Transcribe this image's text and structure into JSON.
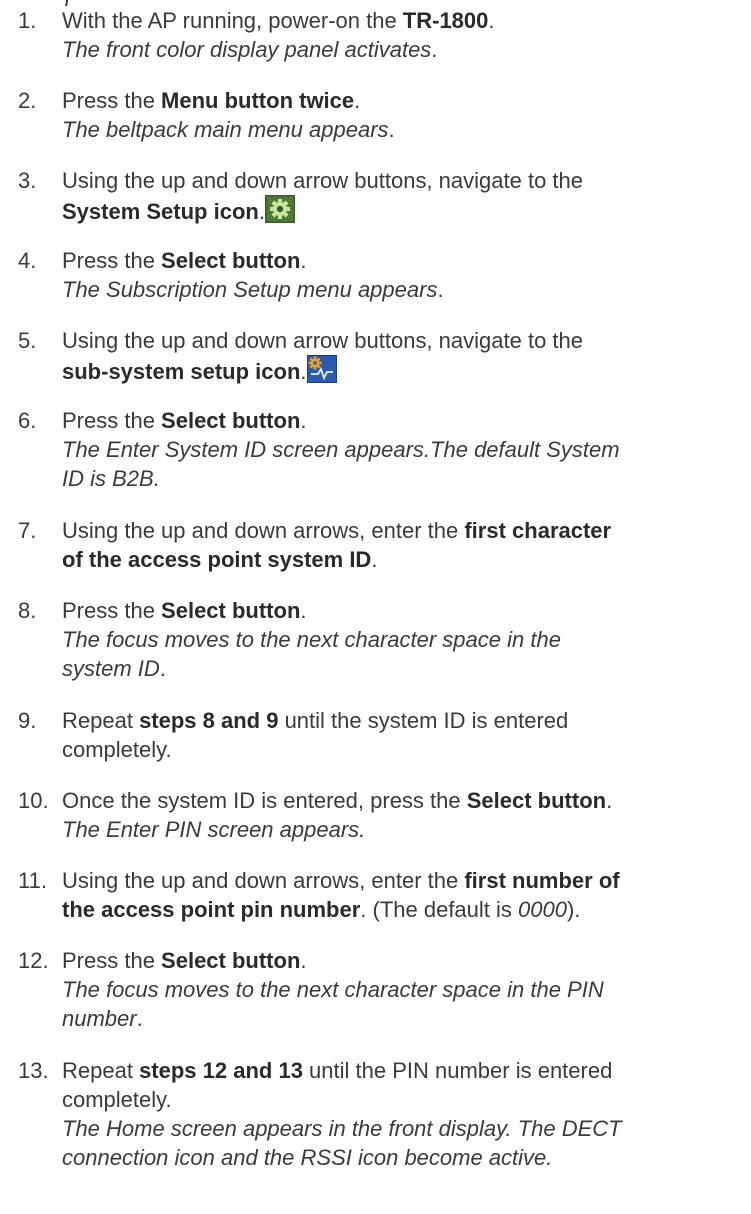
{
  "steps": [
    {
      "num": "1.",
      "lines": [
        [
          {
            "t": "With the AP running, power-on the "
          },
          {
            "t": "TR-1800",
            "b": true
          },
          {
            "t": "."
          }
        ],
        [
          {
            "t": "The front color display panel activates",
            "i": true
          },
          {
            "t": "."
          }
        ]
      ]
    },
    {
      "num": "2.",
      "lines": [
        [
          {
            "t": "Press the "
          },
          {
            "t": "Menu button twice",
            "b": true
          },
          {
            "t": "."
          }
        ],
        [
          {
            "t": "The beltpack main menu appears",
            "i": true
          },
          {
            "t": "."
          }
        ]
      ]
    },
    {
      "num": "3.",
      "lines": [
        [
          {
            "t": "Using the up and down arrow buttons, navigate to the"
          }
        ],
        [
          {
            "t": "System Setup icon",
            "b": true
          },
          {
            "t": "."
          },
          {
            "icon": "gear-icon"
          }
        ]
      ]
    },
    {
      "num": "4.",
      "lines": [
        [
          {
            "t": "Press the "
          },
          {
            "t": "Select button",
            "b": true
          },
          {
            "t": "."
          }
        ],
        [
          {
            "t": "The Subscription Setup menu appears",
            "i": true
          },
          {
            "t": "."
          }
        ]
      ]
    },
    {
      "num": "5.",
      "lines": [
        [
          {
            "t": "Using the up and down arrow buttons, navigate to the"
          }
        ],
        [
          {
            "t": "sub-system setup icon",
            "b": true
          },
          {
            "t": "."
          },
          {
            "icon": "subsystem-setup-icon"
          }
        ]
      ]
    },
    {
      "num": "6.",
      "lines": [
        [
          {
            "t": "Press the "
          },
          {
            "t": "Select button",
            "b": true
          },
          {
            "t": "."
          }
        ],
        [
          {
            "t": "The Enter System ID screen appears.The default System",
            "i": true
          }
        ],
        [
          {
            "t": "ID is B2B.",
            "i": true
          }
        ]
      ]
    },
    {
      "num": "7.",
      "lines": [
        [
          {
            "t": "Using the up and down arrows, enter the "
          },
          {
            "t": "first character",
            "b": true
          }
        ],
        [
          {
            "t": "of the access point system ID",
            "b": true
          },
          {
            "t": "."
          }
        ]
      ]
    },
    {
      "num": "8.",
      "lines": [
        [
          {
            "t": "Press the "
          },
          {
            "t": "Select button",
            "b": true
          },
          {
            "t": "."
          }
        ],
        [
          {
            "t": "The focus moves to the next character space in the",
            "i": true
          }
        ],
        [
          {
            "t": "system ID",
            "i": true
          },
          {
            "t": "."
          }
        ]
      ]
    },
    {
      "num": "9.",
      "lines": [
        [
          {
            "t": "Repeat "
          },
          {
            "t": "steps 8 and 9",
            "b": true
          },
          {
            "t": " until the system ID is entered"
          }
        ],
        [
          {
            "t": "completely."
          }
        ]
      ]
    },
    {
      "num": "10.",
      "lines": [
        [
          {
            "t": "Once the system ID is entered, press the "
          },
          {
            "t": "Select button",
            "b": true
          },
          {
            "t": "."
          }
        ],
        [
          {
            "t": "The Enter PIN screen appears.",
            "i": true
          }
        ]
      ]
    },
    {
      "num": "11.",
      "lines": [
        [
          {
            "t": "Using the up and down arrows, enter the "
          },
          {
            "t": "first number of",
            "b": true
          }
        ],
        [
          {
            "t": "the access point pin number",
            "b": true
          },
          {
            "t": ". (The default is "
          },
          {
            "t": "0000",
            "i": true
          },
          {
            "t": ")."
          }
        ]
      ]
    },
    {
      "num": "12.",
      "lines": [
        [
          {
            "t": "Press the "
          },
          {
            "t": "Select button",
            "b": true
          },
          {
            "t": "."
          }
        ],
        [
          {
            "t": "The focus moves to the next character space in the PIN",
            "i": true
          }
        ],
        [
          {
            "t": "number",
            "i": true
          },
          {
            "t": "."
          }
        ]
      ]
    },
    {
      "num": "13.",
      "lines": [
        [
          {
            "t": "Repeat "
          },
          {
            "t": "steps 12 and 13",
            "b": true
          },
          {
            "t": " until the PIN number is entered"
          }
        ],
        [
          {
            "t": "completely."
          }
        ],
        [
          {
            "t": "The Home screen appears in the front display. The DECT",
            "i": true
          }
        ],
        [
          {
            "t": "connection icon and the RSSI icon become active.",
            "i": true
          }
        ]
      ]
    }
  ]
}
